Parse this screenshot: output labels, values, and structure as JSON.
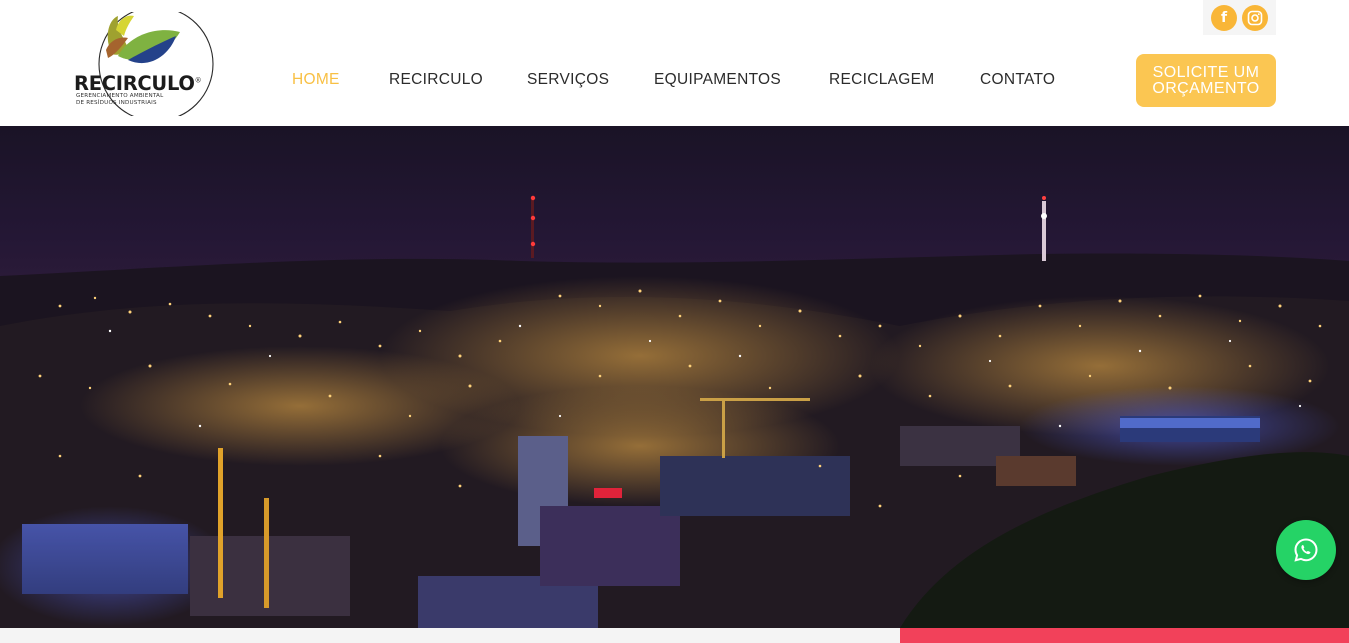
{
  "brand": {
    "name": "RECIRCULO",
    "registered_mark": "®",
    "tagline_line1": "GERENCIAMENTO AMBIENTAL",
    "tagline_line2": "DE RESÍDUOS INDUSTRIAIS"
  },
  "nav": {
    "items": [
      {
        "label": "HOME",
        "active": true
      },
      {
        "label": "RECIRCULO",
        "active": false
      },
      {
        "label": "SERVIÇOS",
        "active": false
      },
      {
        "label": "EQUIPAMENTOS",
        "active": false
      },
      {
        "label": "RECICLAGEM",
        "active": false
      },
      {
        "label": "CONTATO",
        "active": false
      }
    ]
  },
  "social": [
    {
      "icon": "facebook-icon"
    },
    {
      "icon": "instagram-icon"
    }
  ],
  "cta": {
    "label": "SOLICITE UM ORÇAMENTO"
  },
  "hero": {
    "image": "night-city-skyline"
  },
  "whatsapp": {
    "icon": "whatsapp-icon"
  },
  "colors": {
    "accent": "#f8c044",
    "cta_background": "#fbc652",
    "social_background": "#f9b637",
    "whatsapp_green": "#25d366",
    "strip_red": "#f2415a",
    "nav_text": "#2b2b2b"
  }
}
